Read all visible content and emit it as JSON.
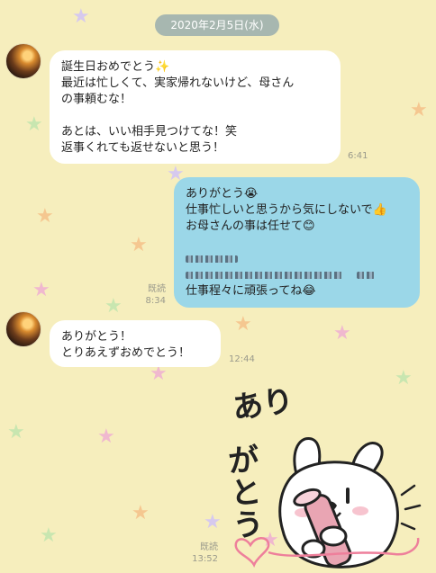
{
  "date_separator": "2020年2月5日(水)",
  "messages": [
    {
      "direction": "incoming",
      "lines": [
        "誕生日おめでとう✨",
        "最近は忙しくて、実家帰れないけど、母さん",
        "の事頼むな！",
        "",
        "あとは、いい相手見つけてな！笑",
        "返事くれても返せないと思う！"
      ],
      "time": "6:41"
    },
    {
      "direction": "outgoing",
      "lines": [
        "ありがとう😭",
        "仕事忙しいと思うから気にしないで👍",
        "お母さんの事は任せて😊",
        "",
        "",
        "",
        "仕事程々に頑張ってね😂"
      ],
      "read_label": "既読",
      "time": "8:34"
    },
    {
      "direction": "incoming",
      "lines": [
        "ありがとう！",
        "とりあえずおめでとう！"
      ],
      "time": "12:44"
    }
  ],
  "sticker": {
    "text_line1": "あり",
    "text_line2": "がとう",
    "read_label": "既読",
    "time": "13:52"
  },
  "colors": {
    "background": "#f6eebd",
    "incoming_bubble": "#ffffff",
    "outgoing_bubble": "#9bd7e8",
    "date_pill": "#a7b7b0"
  }
}
